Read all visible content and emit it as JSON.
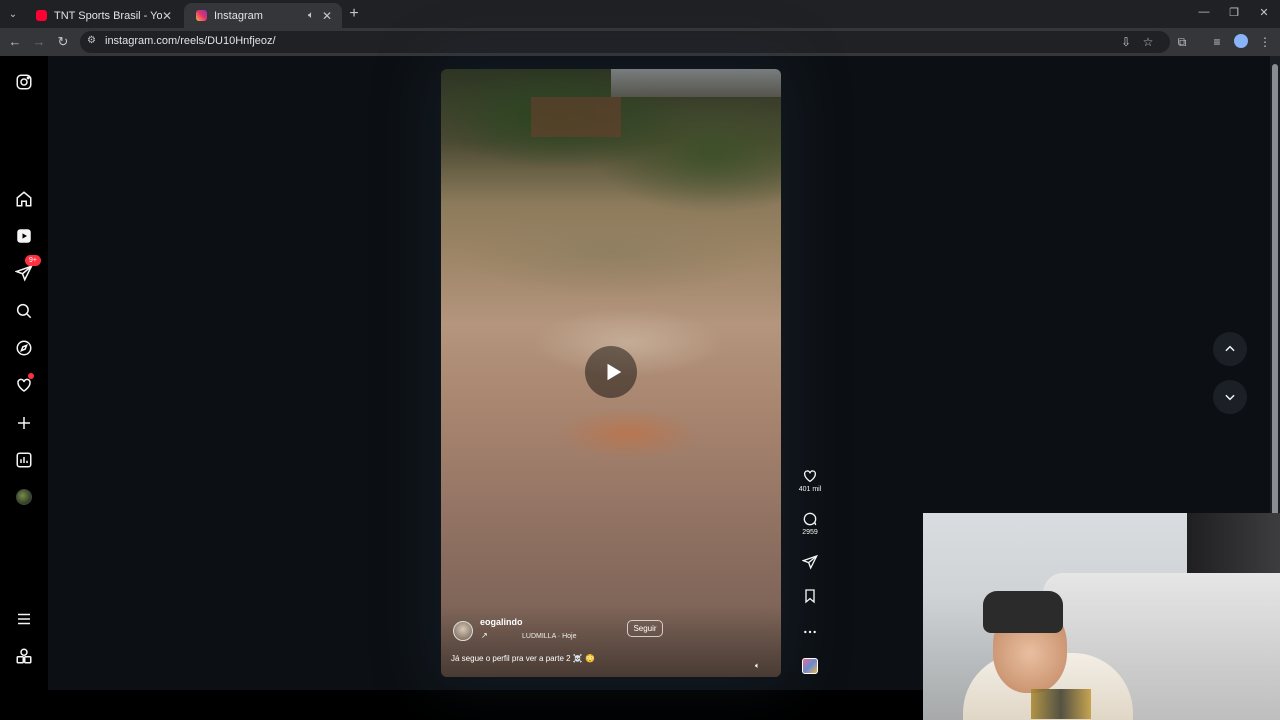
{
  "browser": {
    "tabs": [
      {
        "title": "TNT Sports Brasil - YouTube",
        "active": false
      },
      {
        "title": "Instagram",
        "active": true
      }
    ],
    "url": "instagram.com/reels/DU10Hnfjeoz/"
  },
  "sidebar": {
    "notification_badge": "9+"
  },
  "reel": {
    "author": "eogalindo",
    "music": "LUDMILLA · Hoje",
    "follow_label": "Seguir",
    "caption": "Já segue o perfil pra ver a parte 2 ☠️ 😳"
  },
  "actions": {
    "likes": "401 mil",
    "comments": "2959"
  },
  "colors": {
    "background": "#0c1014",
    "notification": "#ff3040"
  }
}
